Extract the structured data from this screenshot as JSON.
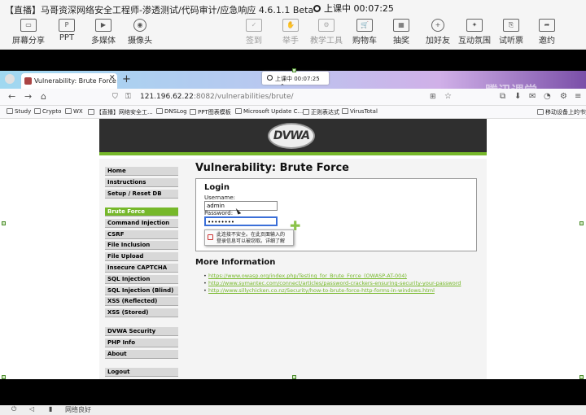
{
  "app": {
    "title": "【直播】马哥资深网络安全工程师-渗透测试/代码审计/应急响应 4.6.1.1 Beta",
    "live_status": "上课中 00:07:25"
  },
  "toolbar": {
    "items": [
      {
        "label": "屏幕分享",
        "icon": "screen-share-icon"
      },
      {
        "label": "PPT",
        "icon": "ppt-icon"
      },
      {
        "label": "多媒体",
        "icon": "media-icon"
      },
      {
        "label": "摄像头",
        "icon": "camera-icon"
      },
      {
        "label": "签到",
        "icon": "checkin-icon"
      },
      {
        "label": "举手",
        "icon": "hand-icon"
      },
      {
        "label": "教学工具",
        "icon": "tools-icon"
      },
      {
        "label": "购物车",
        "icon": "cart-icon"
      },
      {
        "label": "抽奖",
        "icon": "lottery-icon"
      },
      {
        "label": "加好友",
        "icon": "add-friend-icon"
      },
      {
        "label": "互动氛围",
        "icon": "interaction-icon"
      },
      {
        "label": "试听票",
        "icon": "ticket-icon"
      },
      {
        "label": "邀约",
        "icon": "invite-icon"
      }
    ]
  },
  "browser": {
    "tab_title": "Vulnerability: Brute Force :: D",
    "floating_status": "上课中 00:07:25",
    "url_host": "121.196.62.22",
    "url_rest": ":8082/vulnerabilities/brute/",
    "bookmarks": [
      "Study",
      "Crypto",
      "WX",
      "【直播】网络安全工...",
      "DNSLog",
      "PPT图表模板",
      "Microsoft Update C...",
      "正则表达式",
      "VirusTotal",
      "移动设备上的书签"
    ],
    "watermark": "腾讯课堂"
  },
  "dvwa": {
    "logo": "DVWA",
    "menu": {
      "group1": [
        "Home",
        "Instructions",
        "Setup / Reset DB"
      ],
      "group2": [
        "Brute Force",
        "Command Injection",
        "CSRF",
        "File Inclusion",
        "File Upload",
        "Insecure CAPTCHA",
        "SQL Injection",
        "SQL Injection (Blind)",
        "XSS (Reflected)",
        "XSS (Stored)"
      ],
      "group3": [
        "DVWA Security",
        "PHP Info",
        "About"
      ],
      "group4": [
        "Logout"
      ]
    },
    "page_title": "Vulnerability: Brute Force",
    "login": {
      "title": "Login",
      "username_label": "Username:",
      "username_value": "admin",
      "password_label": "Password:",
      "password_value": "••••••••",
      "warning_line1": "此连接不安全。在此页面输入的",
      "warning_line2": "登录信息可以被窃取。详细了解"
    },
    "more_info_title": "More Information",
    "links": [
      "https://www.owasp.org/index.php/Testing_for_Brute_Force_(OWASP-AT-004)",
      "http://www.symantec.com/connect/articles/password-crackers-ensuring-security-your-password",
      "http://www.sillychicken.co.nz/Security/how-to-brute-force-http-forms-in-windows.html"
    ]
  },
  "statusbar": {
    "text": "网络良好"
  }
}
